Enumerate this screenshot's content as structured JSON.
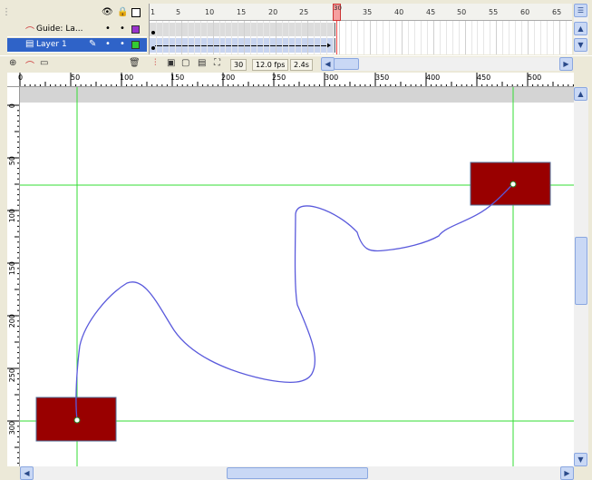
{
  "timeline": {
    "header_icons": {
      "eye": "eye-icon",
      "lock": "lock-icon",
      "outline": "outline-icon"
    },
    "layers": [
      {
        "name": "Guide: La...",
        "icon": "guide-layer-icon",
        "visible_dot": "•",
        "lock_dot": "•",
        "color": "#9933cc"
      },
      {
        "name": "Layer 1",
        "icon": "layer-icon",
        "pencil": "✎",
        "visible_dot": "•",
        "lock_dot": "•",
        "color": "#33cc33",
        "selected": true
      }
    ],
    "frame_numbers": [
      "1",
      "5",
      "10",
      "15",
      "20",
      "25",
      "30",
      "35",
      "40",
      "45",
      "50",
      "55",
      "60",
      "65"
    ],
    "playhead_frame": "30",
    "footer": {
      "current_frame": "30",
      "fps": "12.0 fps",
      "elapsed": "2.4s"
    }
  },
  "rulers": {
    "top": [
      "0",
      "50",
      "100",
      "150",
      "200",
      "250",
      "300",
      "350",
      "400",
      "450",
      "500"
    ],
    "left": [
      "0",
      "50",
      "100",
      "150",
      "200",
      "250",
      "300"
    ]
  },
  "stage": {
    "motion_path_color": "#5a5adc",
    "guide_line_color": "#33dd33",
    "rect_fill": "#990000",
    "rect_border": "#4f6f99"
  }
}
